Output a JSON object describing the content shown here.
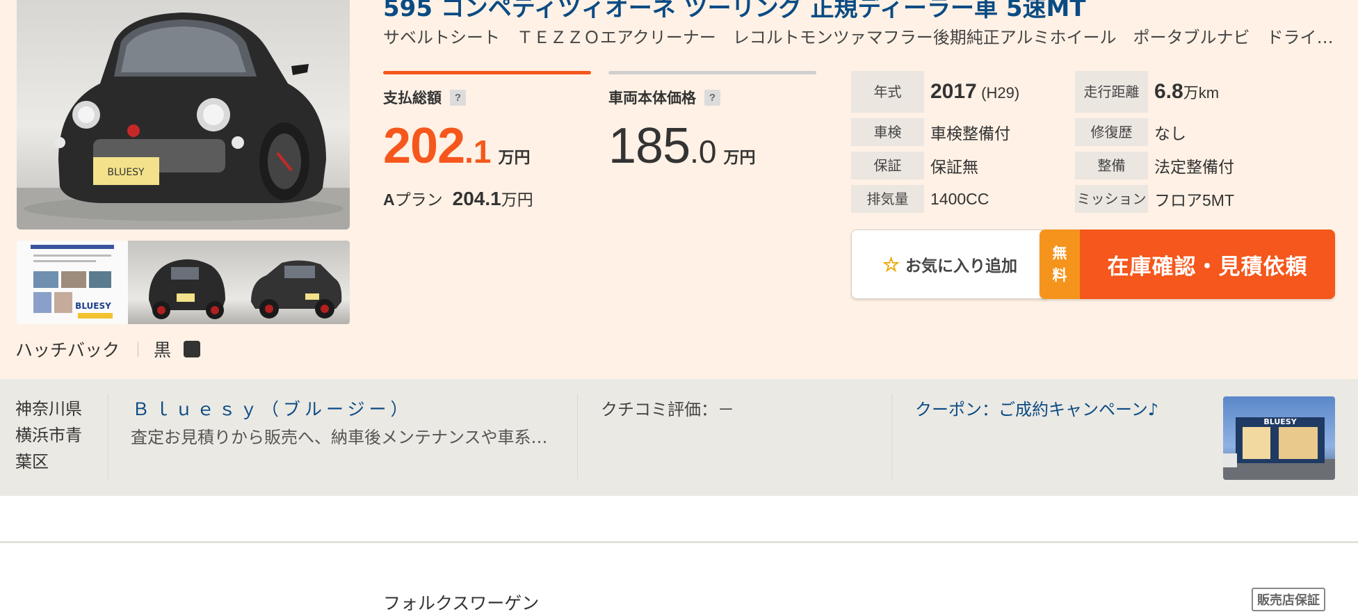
{
  "listing": {
    "title": "595 コンペティツィオーネ ツーリング 正規ディーラー車 5速MT",
    "options": "サベルトシート　ＴＥＺＺＯエアクリーナー　レコルトモンツァマフラー後期純正アルミホイール　ポータブルナビ　ドライブレコーダー",
    "body_type": "ハッチバック",
    "color_name": "黒",
    "color_hex": "#333333",
    "total_price": {
      "label": "支払総額",
      "help": "?",
      "int": "202",
      "dec": ".1",
      "unit": "万円",
      "accent": "#f5571c"
    },
    "body_price": {
      "label": "車両本体価格",
      "help": "?",
      "int": "185",
      "dec": ".0",
      "unit": "万円"
    },
    "aplan": {
      "prefix": "A",
      "label": "プラン",
      "value": "204.1",
      "unit": "万円"
    },
    "specs": {
      "year": {
        "label": "年式",
        "value": "2017",
        "sub": "(H29)"
      },
      "mileage": {
        "label": "走行距離",
        "value": "6.8",
        "unit": "万km"
      },
      "inspection": {
        "label": "車検",
        "value": "車検整備付"
      },
      "repair": {
        "label": "修復歴",
        "value": "なし"
      },
      "warranty": {
        "label": "保証",
        "value": "保証無"
      },
      "maintenance": {
        "label": "整備",
        "value": "法定整備付"
      },
      "displacement": {
        "label": "排気量",
        "value": "1400CC"
      },
      "transmission": {
        "label": "ミッション",
        "value": "フロア5MT"
      }
    },
    "favorite_button": {
      "icon": "star-outline-icon",
      "label": "お気に入り追加"
    },
    "inquiry_button": {
      "free_top": "無",
      "free_bottom": "料",
      "label": "在庫確認・見積依頼",
      "color": "#f5571c",
      "free_color": "#f5941c"
    }
  },
  "shop": {
    "pref_line1": "神奈川県",
    "pref_line2": "横浜市青",
    "pref_line3": "葉区",
    "name": "Ｂｌｕｅｓｙ（ブルージー）",
    "description": "査定お見積りから販売へ、納車後メンテナンスや車系カスタムまで",
    "review": "クチコミ評価：－",
    "coupon": "クーポン：ご成約キャンペーン♪"
  },
  "next_listing": {
    "maker": "フォルクスワーゲン",
    "badge": "販売店保証"
  }
}
